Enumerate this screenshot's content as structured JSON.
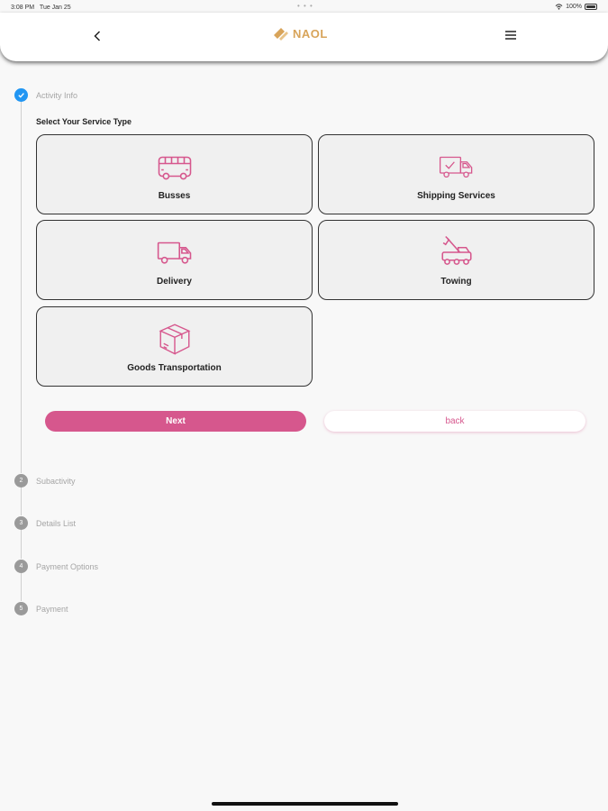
{
  "status_bar": {
    "time": "3:08 PM",
    "date": "Tue Jan 25",
    "dots": "• • •",
    "battery": "100%"
  },
  "header": {
    "logo_text": "NAOL"
  },
  "steps": [
    {
      "number": "1",
      "label": "Activity Info"
    },
    {
      "number": "2",
      "label": "Subactivity"
    },
    {
      "number": "3",
      "label": "Details List"
    },
    {
      "number": "4",
      "label": "Payment Options"
    },
    {
      "number": "5",
      "label": "Payment"
    }
  ],
  "section_title": "Select  Your Service Type",
  "services": [
    {
      "label": "Busses",
      "icon": "bus-icon"
    },
    {
      "label": "Shipping Services",
      "icon": "shipping-truck-icon"
    },
    {
      "label": "Delivery",
      "icon": "delivery-truck-icon"
    },
    {
      "label": "Towing",
      "icon": "tow-truck-icon"
    },
    {
      "label": "Goods Transportation",
      "icon": "box-icon"
    }
  ],
  "buttons": {
    "next": "Next",
    "back": "back"
  },
  "colors": {
    "accent": "#d6578d",
    "step_active": "#2196f3",
    "logo": "#d8a45a"
  }
}
